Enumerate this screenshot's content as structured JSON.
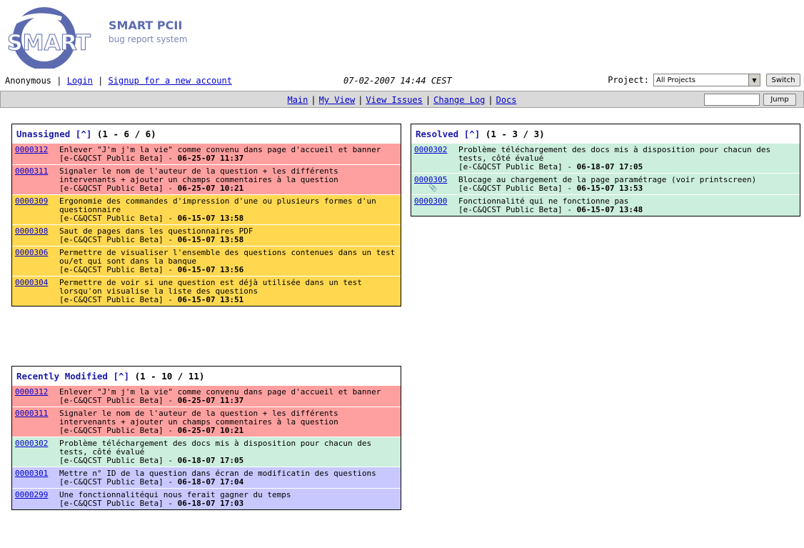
{
  "app": {
    "logo_text": "SMART",
    "title": "SMART PCII",
    "subtitle": "bug report system"
  },
  "loginbar": {
    "user": "Anonymous",
    "login": "Login",
    "signup": "Signup for a new account",
    "datetime": "07-02-2007 14:44 CEST",
    "project_label": "Project:",
    "project_value": "All Projects",
    "switch_label": "Switch"
  },
  "menu": {
    "items": [
      "Main",
      "My View",
      "View Issues",
      "Change Log",
      "Docs"
    ],
    "jump_label": "Jump",
    "jump_value": ""
  },
  "unassigned": {
    "title": "Unassigned",
    "caret": "[^]",
    "range": "(1 - 6 / 6)",
    "rows": [
      {
        "id": "0000312",
        "summary": "Enlever \"J'm j'm la vie\" comme convenu dans page d'accueil et banner",
        "project": "[e-C&QCST Public Beta] - ",
        "date": "06-25-07 11:37",
        "color": "#ffa0a0"
      },
      {
        "id": "0000311",
        "summary": "Signaler le nom de l'auteur de la question + les différents intervenants + ajouter un champs commentaires à la question",
        "project": "[e-C&QCST Public Beta] - ",
        "date": "06-25-07 10:21",
        "color": "#ffa0a0"
      },
      {
        "id": "0000309",
        "summary": "Ergonomie des commandes d'impression d'une ou plusieurs formes d'un questionnaire",
        "project": "[e-C&QCST Public Beta] - ",
        "date": "06-15-07 13:58",
        "color": "#ffd850"
      },
      {
        "id": "0000308",
        "summary": "Saut de pages dans les questionnaires PDF",
        "project": "[e-C&QCST Public Beta] - ",
        "date": "06-15-07 13:58",
        "color": "#ffd850"
      },
      {
        "id": "0000306",
        "summary": "Permettre de visualiser l'ensemble des questions contenues dans un test ou/et qui sont dans la banque",
        "project": "[e-C&QCST Public Beta] - ",
        "date": "06-15-07 13:56",
        "color": "#ffd850"
      },
      {
        "id": "0000304",
        "summary": "Permettre de voir si une question est déjà utilisée dans un test lorsqu'on visualise la liste des questions",
        "project": "[e-C&QCST Public Beta] - ",
        "date": "06-15-07 13:51",
        "color": "#ffd850"
      }
    ]
  },
  "resolved": {
    "title": "Resolved",
    "caret": "[^]",
    "range": "(1 - 3 / 3)",
    "rows": [
      {
        "id": "0000302",
        "summary": "Problème téléchargement des docs mis à disposition pour chacun des tests, côté évalué",
        "project": "[e-C&QCST Public Beta] - ",
        "date": "06-18-07 17:05",
        "color": "#cceedd"
      },
      {
        "id": "0000305",
        "summary": "Blocage au chargement de la page paramétrage (voir printscreen)",
        "project": "[e-C&QCST Public Beta] - ",
        "date": "06-15-07 13:53",
        "color": "#cceedd",
        "attachment": true
      },
      {
        "id": "0000300",
        "summary": "Fonctionnalité qui ne fonctionne pas",
        "project": "[e-C&QCST Public Beta] - ",
        "date": "06-15-07 13:48",
        "color": "#cceedd"
      }
    ]
  },
  "recent": {
    "title": "Recently Modified",
    "caret": "[^]",
    "range": "(1 - 10 / 11)",
    "rows": [
      {
        "id": "0000312",
        "summary": "Enlever \"J'm j'm la vie\" comme convenu dans page d'accueil et banner",
        "project": "[e-C&QCST Public Beta] - ",
        "date": "06-25-07 11:37",
        "color": "#ffa0a0"
      },
      {
        "id": "0000311",
        "summary": "Signaler le nom de l'auteur de la question + les différents intervenants + ajouter un champs commentaires à la question",
        "project": "[e-C&QCST Public Beta] - ",
        "date": "06-25-07 10:21",
        "color": "#ffa0a0"
      },
      {
        "id": "0000302",
        "summary": "Problème téléchargement des docs mis à disposition pour chacun des tests, côté évalué",
        "project": "[e-C&QCST Public Beta] - ",
        "date": "06-18-07 17:05",
        "color": "#cceedd"
      },
      {
        "id": "0000301",
        "summary": "Mettre n° ID de la question dans écran de modificatin des questions",
        "project": "[e-C&QCST Public Beta] - ",
        "date": "06-18-07 17:04",
        "color": "#c8c8ff"
      },
      {
        "id": "0000299",
        "summary": "Une fonctionnalitéqui nous ferait gagner du temps",
        "project": "[e-C&QCST Public Beta] - ",
        "date": "06-18-07 17:03",
        "color": "#c8c8ff"
      }
    ]
  }
}
